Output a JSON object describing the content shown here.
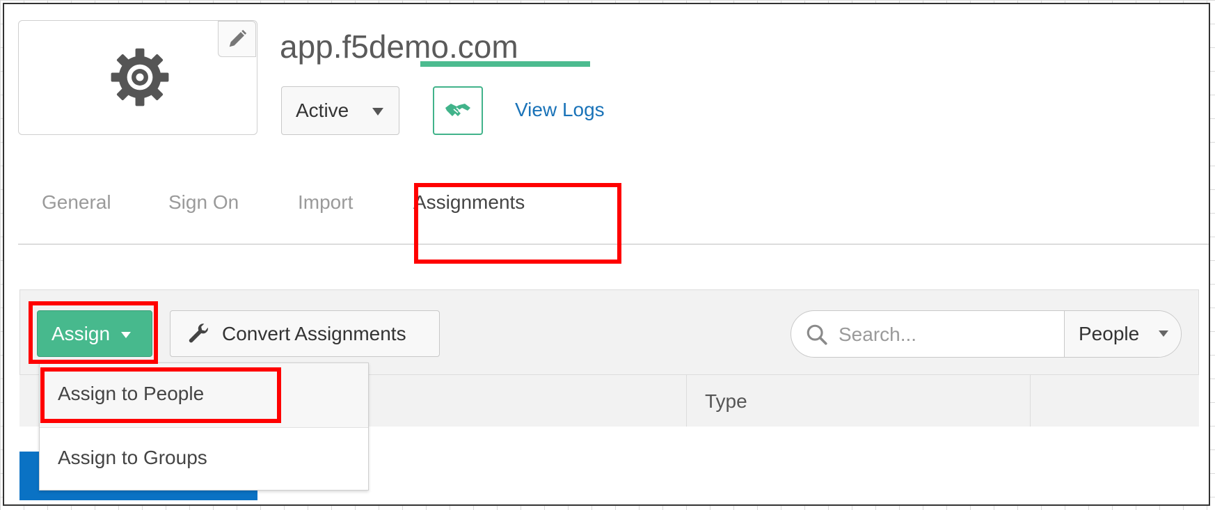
{
  "app": {
    "title": "app.f5demo.com",
    "status": "Active",
    "view_logs": "View Logs"
  },
  "tabs": [
    {
      "label": "General"
    },
    {
      "label": "Sign On"
    },
    {
      "label": "Import"
    },
    {
      "label": "Assignments",
      "active": true
    }
  ],
  "toolbar": {
    "assign_label": "Assign",
    "convert_label": "Convert Assignments",
    "search_placeholder": "Search...",
    "filter_value": "People"
  },
  "assign_menu": {
    "items": [
      "Assign to People",
      "Assign to Groups"
    ]
  },
  "table": {
    "columns": [
      "",
      "Type",
      ""
    ]
  },
  "colors": {
    "accent": "#47b98d",
    "link": "#1a73b8",
    "highlight": "#ff0000",
    "blue_bar": "#0a72c4"
  },
  "icons": [
    "gear-icon",
    "pencil-icon",
    "chevron-down-icon",
    "handshake-icon",
    "wrench-icon",
    "search-icon"
  ]
}
